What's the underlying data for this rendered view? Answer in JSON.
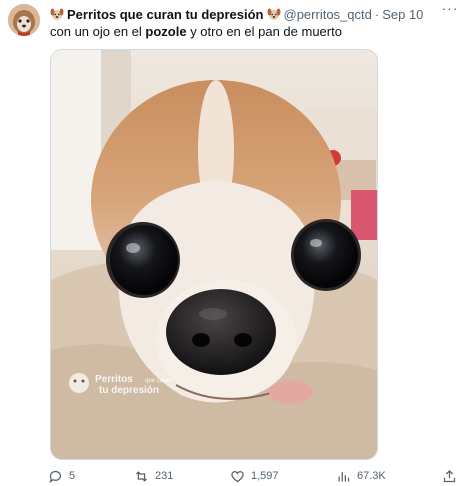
{
  "tweet": {
    "author_name": "Perritos que curan tu depresión",
    "handle": "@perritos_qctd",
    "separator": "·",
    "date": "Sep 10",
    "text_before": "con un ojo en el ",
    "text_bold": "pozole",
    "text_after": " y otro en el pan de muerto",
    "more_label": "···",
    "watermark_line1": "Perritos",
    "watermark_small": "que curan",
    "watermark_line2": "tu depresión"
  },
  "actions": {
    "replies": "5",
    "retweets": "231",
    "likes": "1,597",
    "views": "67.3K"
  },
  "icons": {
    "reply": "reply-icon",
    "retweet": "retweet-icon",
    "like": "heart-icon",
    "views": "bar-chart-icon",
    "share": "share-icon"
  },
  "colors": {
    "text": "#0f1419",
    "muted": "#536471",
    "border": "#cfd9de"
  }
}
